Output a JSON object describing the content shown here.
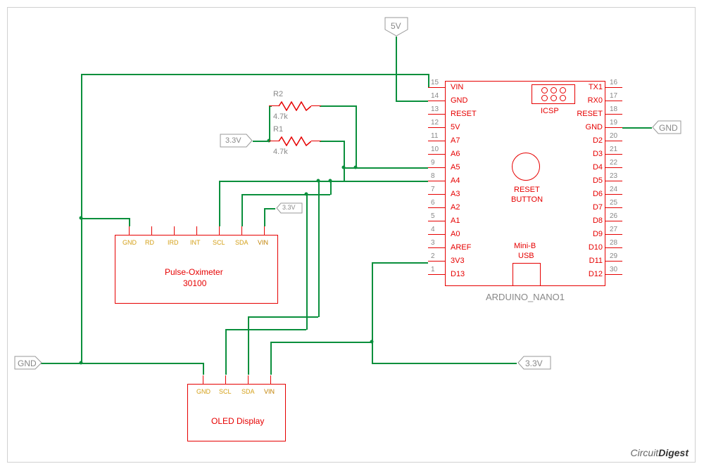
{
  "power": {
    "v5": "5V",
    "v33": "3.3V",
    "gnd": "GND"
  },
  "resistors": {
    "r1_ref": "R1",
    "r1_val": "4.7k",
    "r2_ref": "R2",
    "r2_val": "4.7k"
  },
  "pulse_oximeter": {
    "title1": "Pulse-Oximeter",
    "title2": "30100",
    "pins": [
      "GND",
      "RD",
      "IRD",
      "INT",
      "SCL",
      "SDA",
      "VIN"
    ]
  },
  "oled": {
    "title": "OLED Display",
    "pins": [
      "GND",
      "SCL",
      "SDA",
      "VIN"
    ]
  },
  "arduino": {
    "instance": "ARDUINO_NANO1",
    "icsp": "ICSP",
    "reset_btn1": "RESET",
    "reset_btn2": "BUTTON",
    "usb1": "Mini-B",
    "usb2": "USB",
    "left_pins": [
      {
        "n": "15",
        "lbl": "VIN"
      },
      {
        "n": "14",
        "lbl": "GND"
      },
      {
        "n": "13",
        "lbl": "RESET"
      },
      {
        "n": "12",
        "lbl": "5V"
      },
      {
        "n": "11",
        "lbl": "A7"
      },
      {
        "n": "10",
        "lbl": "A6"
      },
      {
        "n": "9",
        "lbl": "A5"
      },
      {
        "n": "8",
        "lbl": "A4"
      },
      {
        "n": "7",
        "lbl": "A3"
      },
      {
        "n": "6",
        "lbl": "A2"
      },
      {
        "n": "5",
        "lbl": "A1"
      },
      {
        "n": "4",
        "lbl": "A0"
      },
      {
        "n": "3",
        "lbl": "AREF"
      },
      {
        "n": "2",
        "lbl": "3V3"
      },
      {
        "n": "1",
        "lbl": "D13"
      }
    ],
    "right_pins": [
      {
        "n": "16",
        "lbl": "TX1"
      },
      {
        "n": "17",
        "lbl": "RX0"
      },
      {
        "n": "18",
        "lbl": "RESET"
      },
      {
        "n": "19",
        "lbl": "GND"
      },
      {
        "n": "20",
        "lbl": "D2"
      },
      {
        "n": "21",
        "lbl": "D3"
      },
      {
        "n": "22",
        "lbl": "D4"
      },
      {
        "n": "23",
        "lbl": "D5"
      },
      {
        "n": "24",
        "lbl": "D6"
      },
      {
        "n": "25",
        "lbl": "D7"
      },
      {
        "n": "26",
        "lbl": "D8"
      },
      {
        "n": "27",
        "lbl": "D9"
      },
      {
        "n": "28",
        "lbl": "D10"
      },
      {
        "n": "29",
        "lbl": "D11"
      },
      {
        "n": "30",
        "lbl": "D12"
      }
    ]
  },
  "watermark": "CircuitDigest"
}
